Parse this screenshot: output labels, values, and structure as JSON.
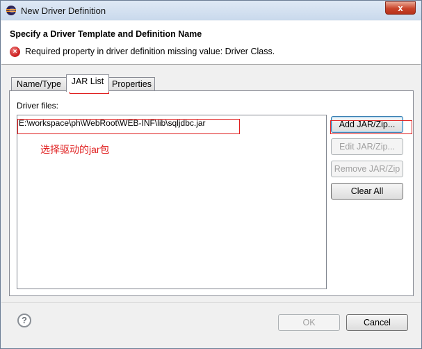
{
  "window": {
    "title": "New Driver Definition",
    "close_glyph": "x"
  },
  "header": {
    "title": "Specify a Driver Template and Definition Name",
    "error_icon": "error-icon",
    "error_message": "Required property in driver definition missing value: Driver Class."
  },
  "tabs": [
    {
      "label": "Name/Type",
      "active": false
    },
    {
      "label": "JAR List",
      "active": true
    },
    {
      "label": "Properties",
      "active": false
    }
  ],
  "jar_panel": {
    "label": "Driver files:",
    "files": [
      "E:\\workspace\\ph\\WebRoot\\WEB-INF\\lib\\sqljdbc.jar"
    ],
    "annotation": "选择驱动的jar包"
  },
  "side_buttons": {
    "add": "Add JAR/Zip...",
    "edit": "Edit JAR/Zip...",
    "remove": "Remove JAR/Zip",
    "clear": "Clear All"
  },
  "footer": {
    "help_glyph": "?",
    "ok": "OK",
    "cancel": "Cancel"
  },
  "colors": {
    "annotation": "#e02020",
    "error": "#c81818"
  }
}
